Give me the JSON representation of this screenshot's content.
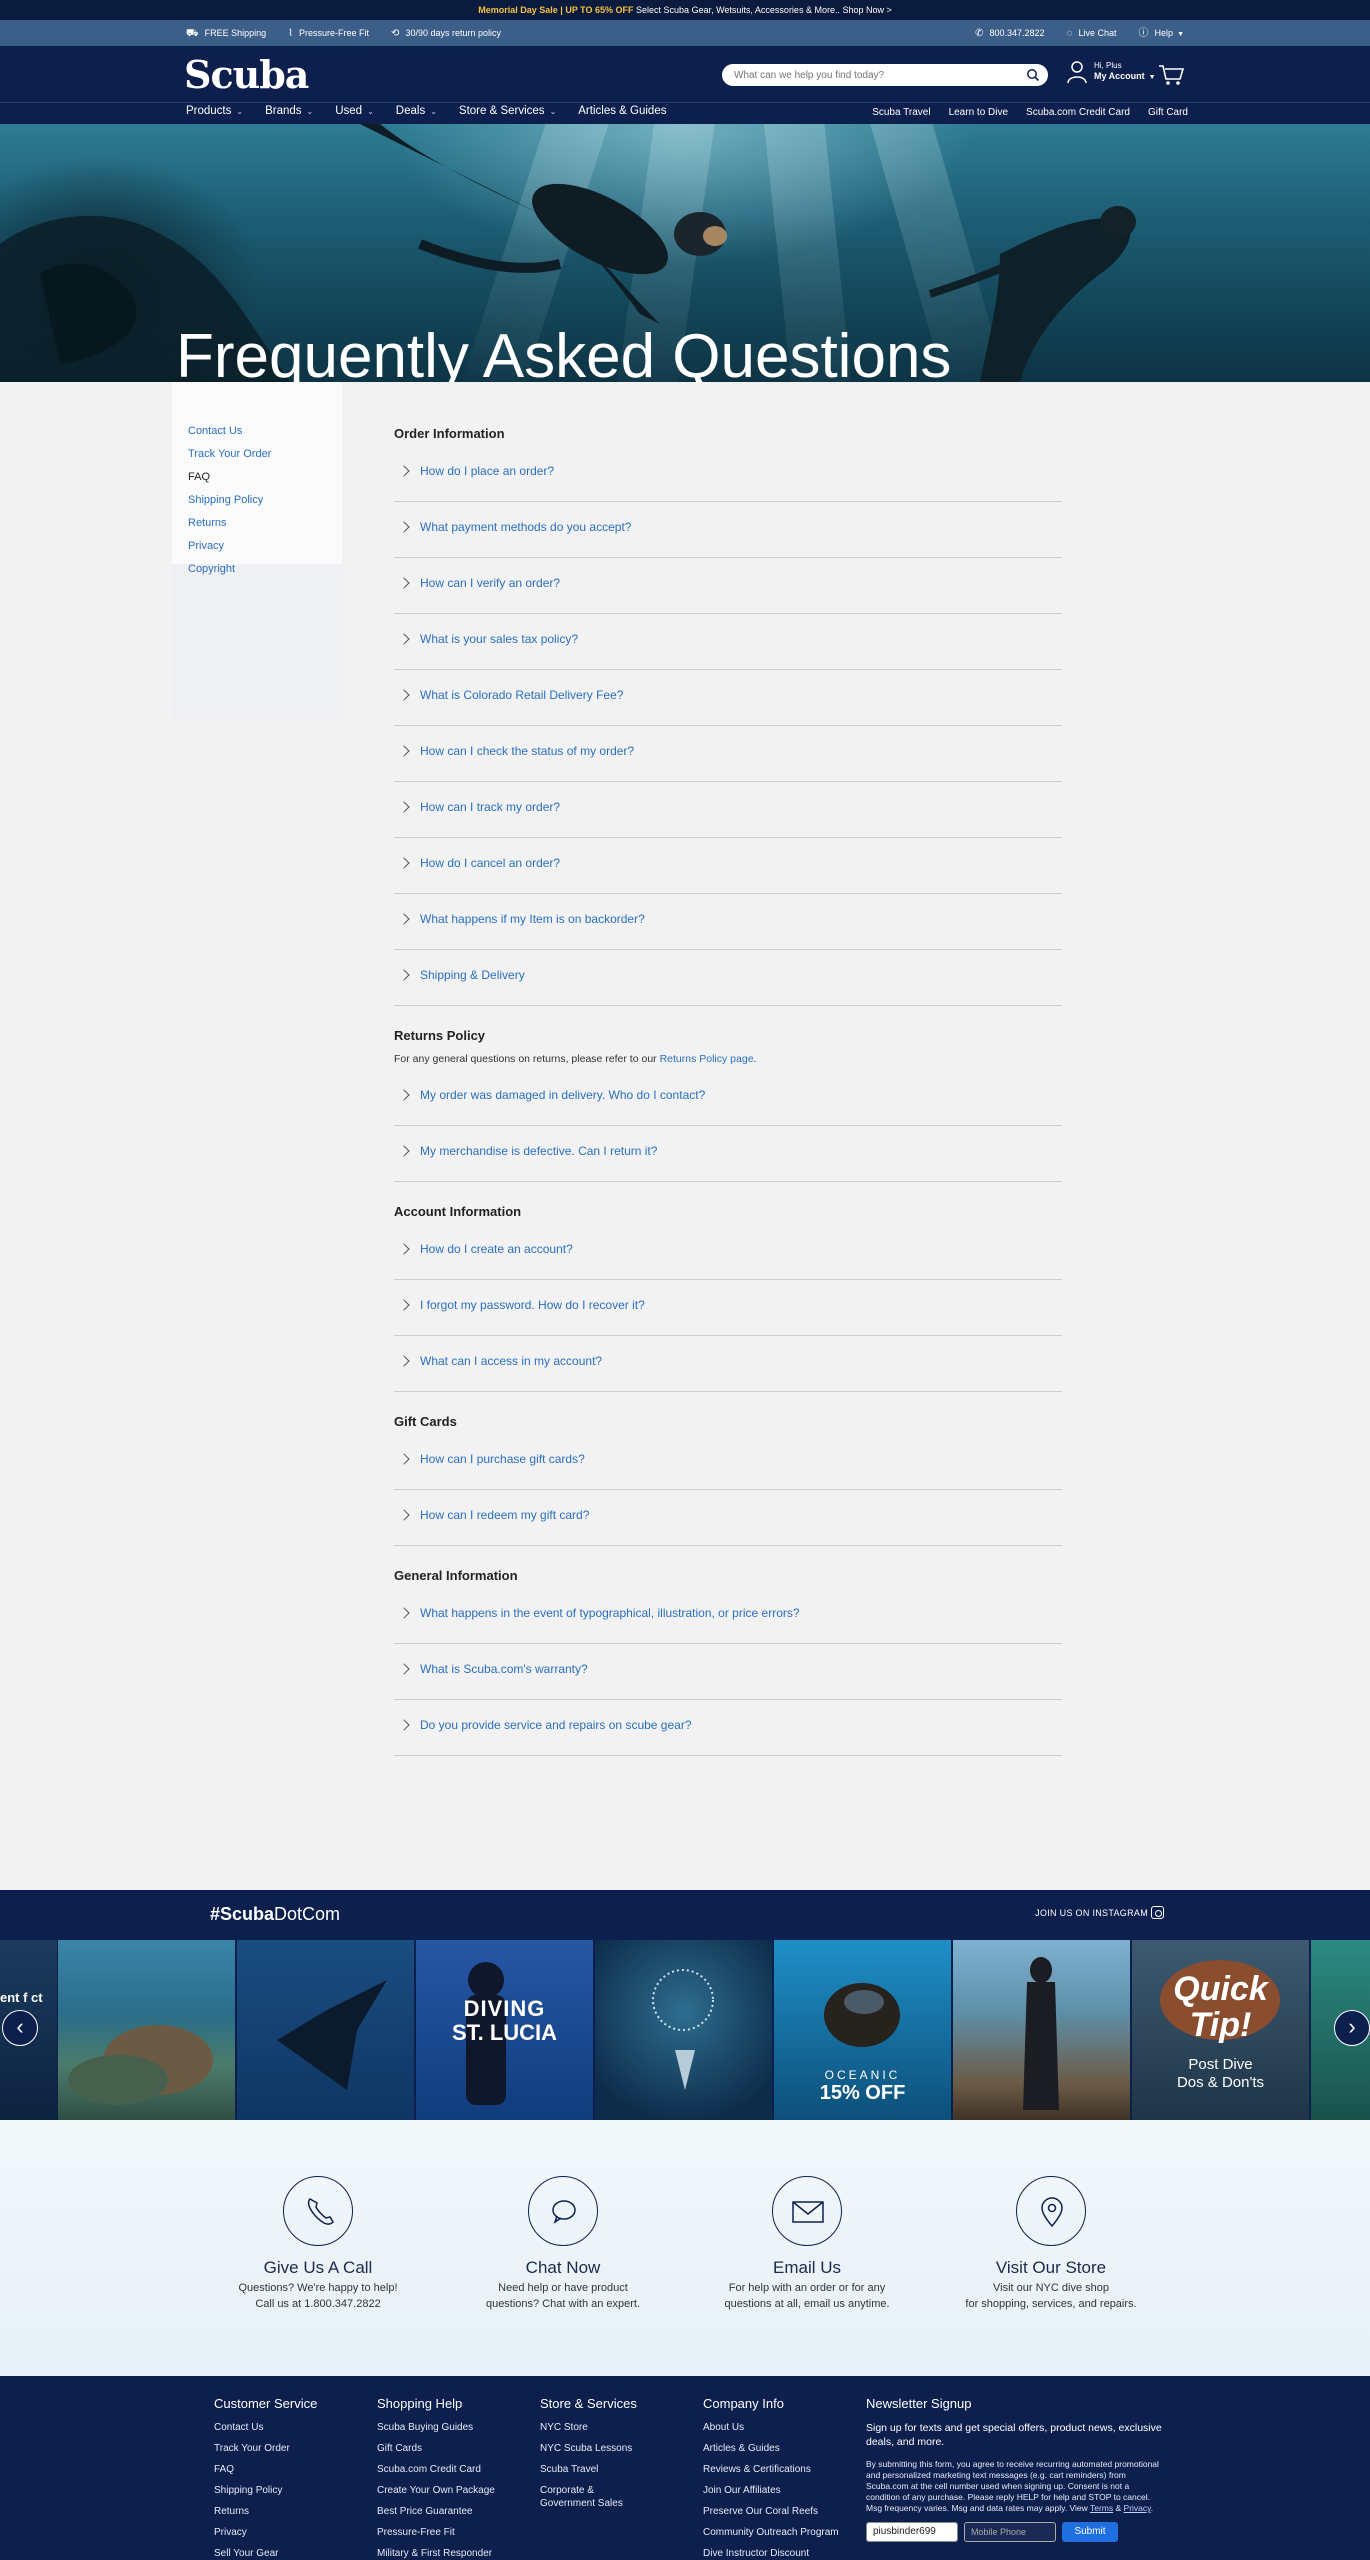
{
  "promo": {
    "highlight": "Memorial Day Sale | UP TO 65% OFF",
    "text": "Select Scuba Gear, Wetsuits, Accessories & More.. Shop Now >"
  },
  "utility": {
    "left": [
      "FREE Shipping",
      "Pressure-Free Fit",
      "30/90 days return policy"
    ],
    "phone": "800.347.2822",
    "live_chat": "Live Chat",
    "help": "Help"
  },
  "header": {
    "logo": "Scuba",
    "search_placeholder": "What can we help you find today?",
    "greeting": "Hi, Plus",
    "account": "My Account"
  },
  "nav": {
    "main": [
      "Products",
      "Brands",
      "Used",
      "Deals",
      "Store & Services",
      "Articles & Guides"
    ],
    "right": [
      "Scuba Travel",
      "Learn to Dive",
      "Scuba.com Credit Card",
      "Gift Card"
    ]
  },
  "hero": {
    "title": "Frequently Asked Questions"
  },
  "sidebar": {
    "items": [
      "Contact Us",
      "Track Your Order",
      "FAQ",
      "Shipping Policy",
      "Returns",
      "Privacy",
      "Copyright"
    ]
  },
  "faq": {
    "order": {
      "title": "Order Information",
      "questions": [
        "How do I place an order?",
        "What payment methods do you accept?",
        "How can I verify an order?",
        "What is your sales tax policy?",
        "What is Colorado Retail Delivery Fee?",
        "How can I check the status of my order?",
        "How can I track my order?",
        "How do I cancel an order?",
        "What happens if my Item is on backorder?",
        "Shipping & Delivery"
      ]
    },
    "returns": {
      "title": "Returns Policy",
      "note_prefix": "For any general questions on returns, please refer to our",
      "note_link": "Returns Policy page",
      "note_suffix": ".",
      "questions": [
        "My order was damaged in delivery. Who do I contact?",
        "My merchandise is defective. Can I return it?"
      ]
    },
    "account": {
      "title": "Account Information",
      "questions": [
        "How do I create an account?",
        "I forgot my password. How do I recover it?",
        "What can I access in my account?"
      ]
    },
    "gift": {
      "title": "Gift Cards",
      "questions": [
        "How can I purchase gift cards?",
        "How can I redeem my gift card?"
      ]
    },
    "general": {
      "title": "General Information",
      "questions": [
        "What happens in the event of typographical, illustration, or price errors?",
        "What is Scuba.com's warranty?",
        "Do you provide service and repairs on scube gear?"
      ]
    }
  },
  "instagram": {
    "hashtag_bold": "#Scuba",
    "hashtag_rest": "DotCom",
    "join": "JOIN US ON INSTAGRAM",
    "tiles": {
      "t0": "ent\nf\nct",
      "t3_line1": "DIVING",
      "t3_line2": "ST. LUCIA",
      "t6_brand": "OCEANIC",
      "t6_offer": "15% OFF",
      "t8_line1": "Quick",
      "t8_line2": "Tip!",
      "t8_line3": "Post Dive",
      "t8_line4": "Dos & Don'ts"
    }
  },
  "contact": [
    {
      "title": "Give Us A Call",
      "line1": "Questions? We're happy to help!",
      "line2": "Call us at 1.800.347.2822",
      "icon": "phone-icon"
    },
    {
      "title": "Chat Now",
      "line1": "Need help or have product",
      "line2": "questions? Chat with an expert.",
      "icon": "chat-icon"
    },
    {
      "title": "Email Us",
      "line1": "For help with an order or for any",
      "line2": "questions at all, email us anytime.",
      "icon": "mail-icon"
    },
    {
      "title": "Visit Our Store",
      "line1": "Visit our NYC dive shop",
      "line2": "for shopping, services, and repairs.",
      "icon": "location-icon"
    }
  ],
  "footer": {
    "customer_service": {
      "title": "Customer Service",
      "links": [
        "Contact Us",
        "Track Your Order",
        "FAQ",
        "Shipping Policy",
        "Returns",
        "Privacy",
        "Sell Your Gear"
      ]
    },
    "shopping_help": {
      "title": "Shopping Help",
      "links": [
        "Scuba Buying Guides",
        "Gift Cards",
        "Scuba.com Credit Card",
        "Create Your Own Package",
        "Best Price Guarantee",
        "Pressure-Free Fit",
        "Military & First Responder"
      ]
    },
    "store_services": {
      "title": "Store & Services",
      "links": [
        "NYC Store",
        "NYC Scuba Lessons",
        "Scuba Travel",
        "Corporate &",
        "Government Sales"
      ]
    },
    "company": {
      "title": "Company Info",
      "links": [
        "About Us",
        "Articles & Guides",
        "Reviews & Certifications",
        "Join Our Affiliates",
        "Preserve Our Coral Reefs",
        "Community Outreach Program",
        "Dive Instructor Discount"
      ]
    },
    "newsletter": {
      "title": "Newsletter Signup",
      "text": "Sign up for texts and get special offers, product news, exclusive deals, and more.",
      "legal": "By submitting this form, you agree to receive recurring automated promotional and personalized marketing text messages (e.g. cart reminders) from Scuba.com at the cell number used when signing up. Consent is not a condition of any purchase. Please reply HELP for help and STOP to cancel. Msg frequency varies. Msg and data rates may apply. View",
      "terms": "Terms",
      "amp": "&",
      "privacy": "Privacy",
      "email_value": "piusbinder699",
      "phone_placeholder": "Mobile Phone",
      "submit": "Submit"
    }
  },
  "colors": {
    "navy": "#0d1f4d",
    "link": "#2a6fbf",
    "util": "#3b5f88",
    "promo_highlight": "#f6c343",
    "submit": "#1e6fe0"
  }
}
